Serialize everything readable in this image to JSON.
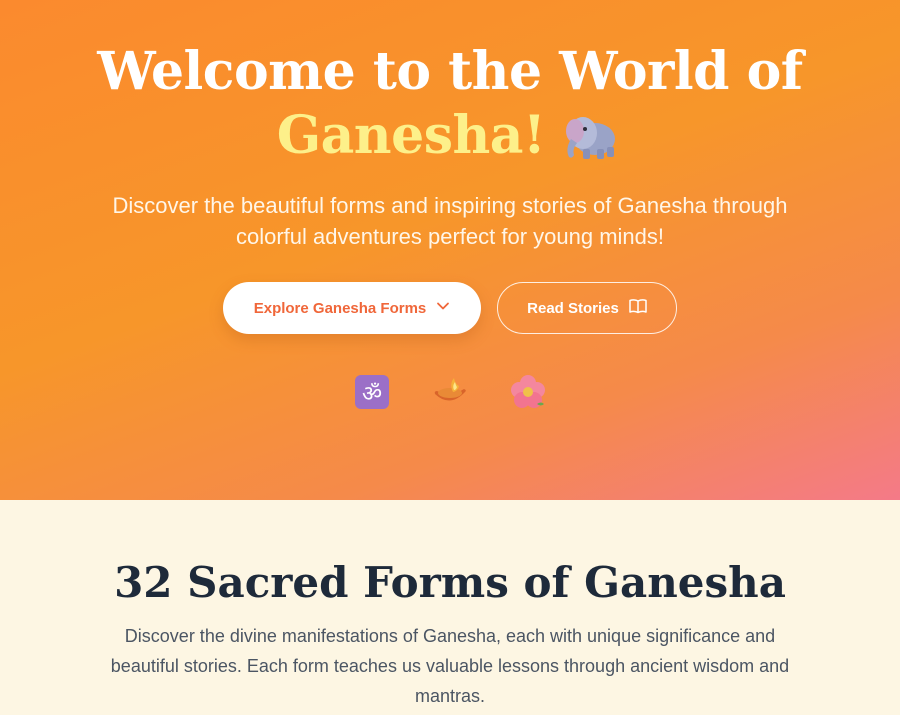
{
  "hero": {
    "title_line1": "Welcome to the World of",
    "title_accent": "Ganesha!",
    "subtitle": "Discover the beautiful forms and inspiring stories of Ganesha through colorful adventures perfect for young minds!",
    "primary_button": "Explore Ganesha Forms",
    "secondary_button": "Read Stories",
    "icons": [
      "om-symbol-icon",
      "diya-lamp-icon",
      "hibiscus-flower-icon"
    ]
  },
  "forms_section": {
    "title": "32 Sacred Forms of Ganesha",
    "description": "Discover the divine manifestations of Ganesha, each with unique significance and beautiful stories. Each form teaches us valuable lessons through ancient wisdom and mantras."
  },
  "colors": {
    "hero_gradient_start": "#fb8a2e",
    "hero_gradient_end": "#f47a88",
    "accent_yellow": "#fdf08a",
    "primary_button_text": "#f0673a",
    "section_background": "#fdf6e3",
    "section_title": "#1e2a3a"
  }
}
